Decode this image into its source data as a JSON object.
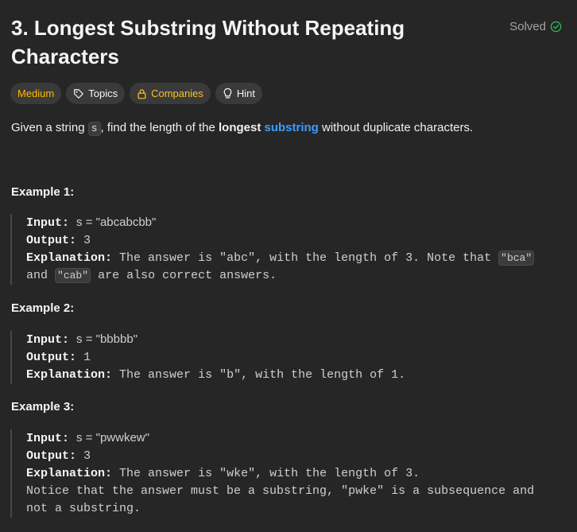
{
  "problem": {
    "title": "3. Longest Substring Without Repeating Characters",
    "status": "Solved"
  },
  "tags": {
    "difficulty": "Medium",
    "topics": "Topics",
    "companies": "Companies",
    "hint": "Hint"
  },
  "description": {
    "prefix": "Given a string ",
    "var": "s",
    "mid": ", find the length of the ",
    "bold": "longest",
    "link": "substring",
    "suffix": " without duplicate characters."
  },
  "examples": [
    {
      "heading": "Example 1:",
      "input_label": "Input:",
      "input_value": "s = \"abcabcbb\"",
      "output_label": "Output:",
      "output_value": "3",
      "explanation_label": "Explanation:",
      "explanation_text": "The answer is \"abc\", with the length of 3. Note that",
      "chip1": "\"bca\"",
      "and_text": "and",
      "chip2": "\"cab\"",
      "tail_text": "are also correct answers."
    },
    {
      "heading": "Example 2:",
      "input_label": "Input:",
      "input_value": "s = \"bbbbb\"",
      "output_label": "Output:",
      "output_value": "1",
      "explanation_label": "Explanation:",
      "explanation_text": "The answer is \"b\", with the length of 1."
    },
    {
      "heading": "Example 3:",
      "input_label": "Input:",
      "input_value": "s = \"pwwkew\"",
      "output_label": "Output:",
      "output_value": "3",
      "explanation_label": "Explanation:",
      "explanation_text": "The answer is \"wke\", with the length of 3.",
      "note_line1": "Notice that the answer must be a substring, \"pwke\" is a subsequence and",
      "note_line2": "not a substring."
    }
  ],
  "colors": {
    "background": "#262626",
    "medium": "#ffb800",
    "companies": "#ffc01e",
    "link": "#3b9cff",
    "solved_check": "#2cbb5d"
  },
  "icons": [
    "check-circle-icon",
    "tag-icon",
    "lock-icon",
    "lightbulb-icon"
  ]
}
